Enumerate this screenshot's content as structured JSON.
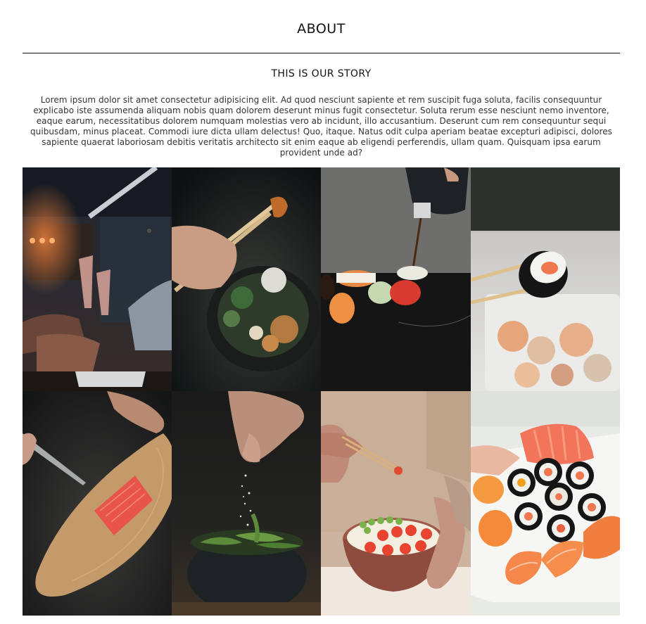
{
  "page": {
    "title": "ABOUT"
  },
  "story": {
    "heading": "THIS IS OUR STORY",
    "text": "Lorem ipsum dolor sit amet consectetur adipisicing elit. Ad quod nesciunt sapiente et rem suscipit fuga soluta, facilis consequuntur explicabo iste assumenda aliquam nobis quam dolorem deserunt minus fugit consectetur. Soluta rerum esse nesciunt nemo inventore, eaque earum, necessitatibus dolorem numquam molestias vero ab incidunt, illo accusantium. Deserunt cum rem consequuntur sequi quibusdam, minus placeat. Commodi iure dicta ullam delectus! Quo, itaque. Natus odit culpa aperiam beatae excepturi adipisci, dolores sapiente quaerat laboriosam debitis veritatis architecto sit enim eaque ab eligendi perferendis, ullam quam. Quisquam ipsa earum provident unde ad?"
  },
  "gallery": {
    "images": [
      {
        "name": "gallery-photo-toast",
        "subject": "friends toasting with champagne glasses in a bar"
      },
      {
        "name": "gallery-photo-bowl-chopsticks",
        "subject": "chopsticks lifting food from a dark bowl"
      },
      {
        "name": "gallery-photo-sushi-sauce",
        "subject": "sauce poured over sushi on slate"
      },
      {
        "name": "gallery-photo-sushi-roll",
        "subject": "chopsticks holding a sushi roll"
      },
      {
        "name": "gallery-photo-salmon-board",
        "subject": "salmon fillet on wooden board with knife"
      },
      {
        "name": "gallery-photo-edamame",
        "subject": "salt sprinkled over edamame bowl"
      },
      {
        "name": "gallery-photo-poke-bowl",
        "subject": "person holding poke bowl with chopsticks"
      },
      {
        "name": "gallery-photo-sushi-platter",
        "subject": "platter of assorted sushi"
      }
    ]
  },
  "colors": {
    "text": "#111111",
    "divider": "#111111",
    "background": "#ffffff"
  }
}
